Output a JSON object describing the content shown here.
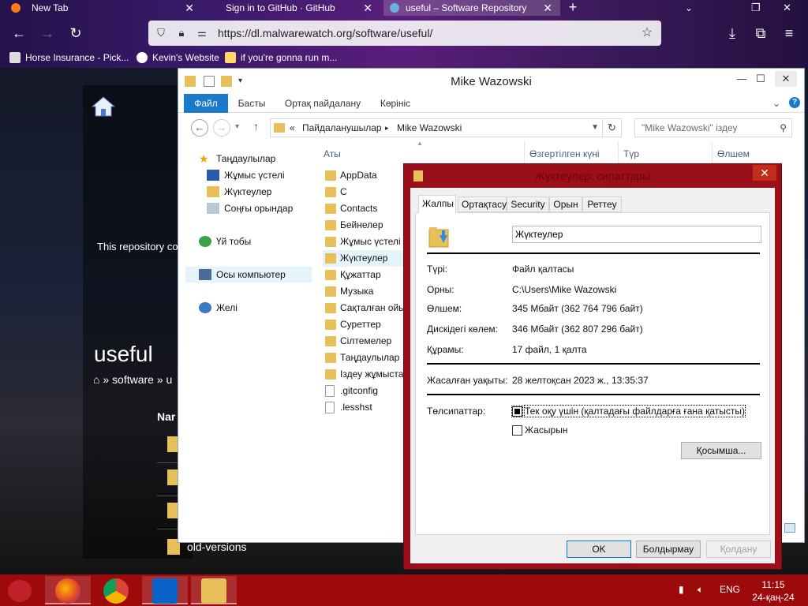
{
  "browser": {
    "tabs": [
      {
        "label": "New Tab",
        "active": false
      },
      {
        "label": "Sign in to GitHub · GitHub",
        "active": false
      },
      {
        "label": "useful – Software Repository",
        "active": true
      }
    ],
    "url": "https://dl.malwarewatch.org/software/useful/",
    "bookmarks": [
      {
        "label": "Horse Insurance - Pick..."
      },
      {
        "label": "Kevin's Website"
      },
      {
        "label": "if you're gonna run m..."
      }
    ]
  },
  "page": {
    "note": "This repository co",
    "title": "useful",
    "breadcrumb": "» software » u",
    "name_col": "Nar",
    "last_row": "old-versions"
  },
  "explorer": {
    "title": "Mike Wazowski",
    "ribbon_tabs": [
      "Файл",
      "Басты",
      "Ортақ пайдалану",
      "Көрініс"
    ],
    "address": {
      "sep": "«",
      "crumbs": [
        "Пайдаланушылар",
        "Mike Wazowski"
      ]
    },
    "search_placeholder": "\"Mike Wazowski\" іздеу",
    "nav": [
      {
        "label": "Таңдаулылар",
        "icon": "star-icon"
      },
      {
        "label": "Жұмыс үстелі",
        "icon": "desktop-icon"
      },
      {
        "label": "Жүктеулер",
        "icon": "downloads-icon"
      },
      {
        "label": "Соңғы орындар",
        "icon": "recent-places-icon"
      },
      {
        "label": "Үй тобы",
        "icon": "homegroup-icon"
      },
      {
        "label": "Осы компьютер",
        "icon": "computer-icon"
      },
      {
        "label": "Желі",
        "icon": "network-icon"
      }
    ],
    "columns": [
      "Аты",
      "Өзгертілген күні",
      "Түр",
      "Өлшем"
    ],
    "files": [
      {
        "name": "AppData",
        "type": "folder"
      },
      {
        "name": "C",
        "type": "folder"
      },
      {
        "name": "Contacts",
        "type": "folder"
      },
      {
        "name": "Бейнелер",
        "type": "folder"
      },
      {
        "name": "Жұмыс үстелі",
        "type": "folder"
      },
      {
        "name": "Жүктеулер",
        "type": "folder"
      },
      {
        "name": "Құжаттар",
        "type": "folder"
      },
      {
        "name": "Музыка",
        "type": "folder"
      },
      {
        "name": "Сақталған ойы",
        "type": "folder"
      },
      {
        "name": "Суреттер",
        "type": "folder"
      },
      {
        "name": "Сілтемелер",
        "type": "folder"
      },
      {
        "name": "Таңдаулылар",
        "type": "folder"
      },
      {
        "name": "Іздеу жұмыстар",
        "type": "folder"
      },
      {
        "name": ".gitconfig",
        "type": "file"
      },
      {
        "name": ".lesshst",
        "type": "file"
      }
    ]
  },
  "properties": {
    "title": "Жүктеулер: сипаттары",
    "tabs": [
      "Жалпы",
      "Ортақтасу",
      "Security",
      "Орын",
      "Реттеу"
    ],
    "name": "Жүктеулер",
    "rows": [
      {
        "label": "Түрі:",
        "value": "Файл қалтасы"
      },
      {
        "label": "Орны:",
        "value": "C:\\Users\\Mike Wazowski"
      },
      {
        "label": "Өлшем:",
        "value": "345 Мбайт (362 764 796 байт)"
      },
      {
        "label": "Дискідегі көлем:",
        "value": "346 Мбайт (362 807 296 байт)"
      },
      {
        "label": "Құрамы:",
        "value": "17 файл, 1 қалта"
      }
    ],
    "created": {
      "label": "Жасалған уақыты:",
      "value": "28 желтоқсан 2023 ж., 13:35:37"
    },
    "attributes_label": "Төлсипаттар:",
    "readonly_label": "Тек оқу үшін (қалтадағы файлдарға ғана қатысты)",
    "hidden_label": "Жасырын",
    "advanced_label": "Қосымша...",
    "ok_label": "OK",
    "cancel_label": "Болдырмау",
    "apply_label": "Қолдану"
  },
  "taskbar": {
    "language": "ENG",
    "time": "11:15",
    "date": "24-қаң-24"
  },
  "colors": {
    "taskbar": "#9c0a0c",
    "dialog_frame": "#9b0f1a",
    "ribbon_file": "#1979ca",
    "folder": "#e8c05a"
  }
}
